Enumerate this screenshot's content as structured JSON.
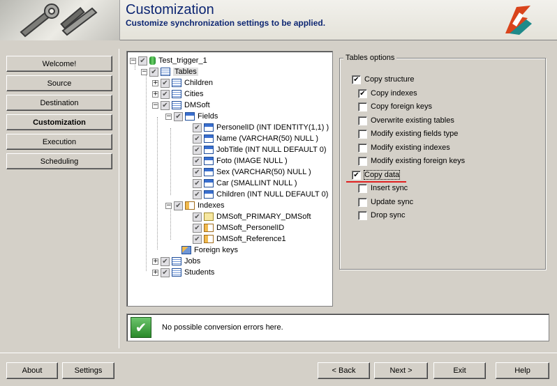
{
  "header": {
    "title": "Customization",
    "subtitle": "Customize synchronization settings to be applied."
  },
  "nav": {
    "items": [
      {
        "label": "Welcome!"
      },
      {
        "label": "Source"
      },
      {
        "label": "Destination"
      },
      {
        "label": "Customization"
      },
      {
        "label": "Execution"
      },
      {
        "label": "Scheduling"
      }
    ]
  },
  "tree": {
    "root": "Test_trigger_1",
    "tables": "Tables",
    "children": "Children",
    "cities": "Cities",
    "dmsoft": "DMSoft",
    "fields": "Fields",
    "field_items": [
      "PersonelID (INT IDENTITY(1,1) )",
      "Name (VARCHAR(50) NULL )",
      "JobTitle (INT NULL  DEFAULT 0)",
      "Foto (IMAGE NULL )",
      "Sex (VARCHAR(50) NULL )",
      "Car (SMALLINT NULL )",
      "Children (INT NULL  DEFAULT 0)"
    ],
    "indexes": "Indexes",
    "index_items": [
      "DMSoft_PRIMARY_DMSoft",
      "DMSoft_PersonelID",
      "DMSoft_Reference1"
    ],
    "foreign_keys": "Foreign keys",
    "jobs": "Jobs",
    "students": "Students"
  },
  "options": {
    "legend": "Tables options",
    "items": [
      {
        "label": "Copy structure",
        "checked": true
      },
      {
        "label": "Copy indexes",
        "checked": true
      },
      {
        "label": "Copy foreign keys",
        "checked": false
      },
      {
        "label": "Overwrite existing tables",
        "checked": false
      },
      {
        "label": "Modify existing fields type",
        "checked": false
      },
      {
        "label": "Modify existing indexes",
        "checked": false
      },
      {
        "label": "Modify existing foreign keys",
        "checked": false
      },
      {
        "label": "Copy data",
        "checked": true
      },
      {
        "label": "Insert sync",
        "checked": false
      },
      {
        "label": "Update sync",
        "checked": false
      },
      {
        "label": "Drop sync",
        "checked": false
      }
    ]
  },
  "status": {
    "text": "No possible conversion errors here."
  },
  "buttons": {
    "about": "About",
    "settings": "Settings",
    "back": "< Back",
    "next": "Next >",
    "exit": "Exit",
    "help": "Help"
  },
  "colors": {
    "title": "#0d2672",
    "window_bg": "#d4d0c8",
    "annotation_red": "#e02020"
  },
  "icons": {
    "checked_mark": "✔",
    "expand": "+",
    "collapse": "−"
  }
}
